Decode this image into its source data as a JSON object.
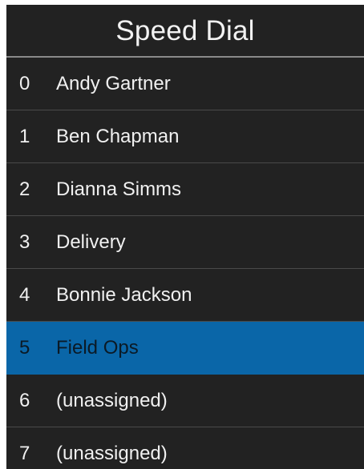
{
  "title": "Speed Dial",
  "selected_index": 5,
  "colors": {
    "background": "#222222",
    "text": "#f0f0f0",
    "selected_row": "#0a66a8",
    "divider": "#4a4a4a"
  },
  "entries": [
    {
      "number": "0",
      "name": "Andy Gartner"
    },
    {
      "number": "1",
      "name": "Ben Chapman"
    },
    {
      "number": "2",
      "name": "Dianna Simms"
    },
    {
      "number": "3",
      "name": "Delivery"
    },
    {
      "number": "4",
      "name": "Bonnie Jackson"
    },
    {
      "number": "5",
      "name": "Field Ops"
    },
    {
      "number": "6",
      "name": "(unassigned)"
    },
    {
      "number": "7",
      "name": "(unassigned)"
    }
  ]
}
